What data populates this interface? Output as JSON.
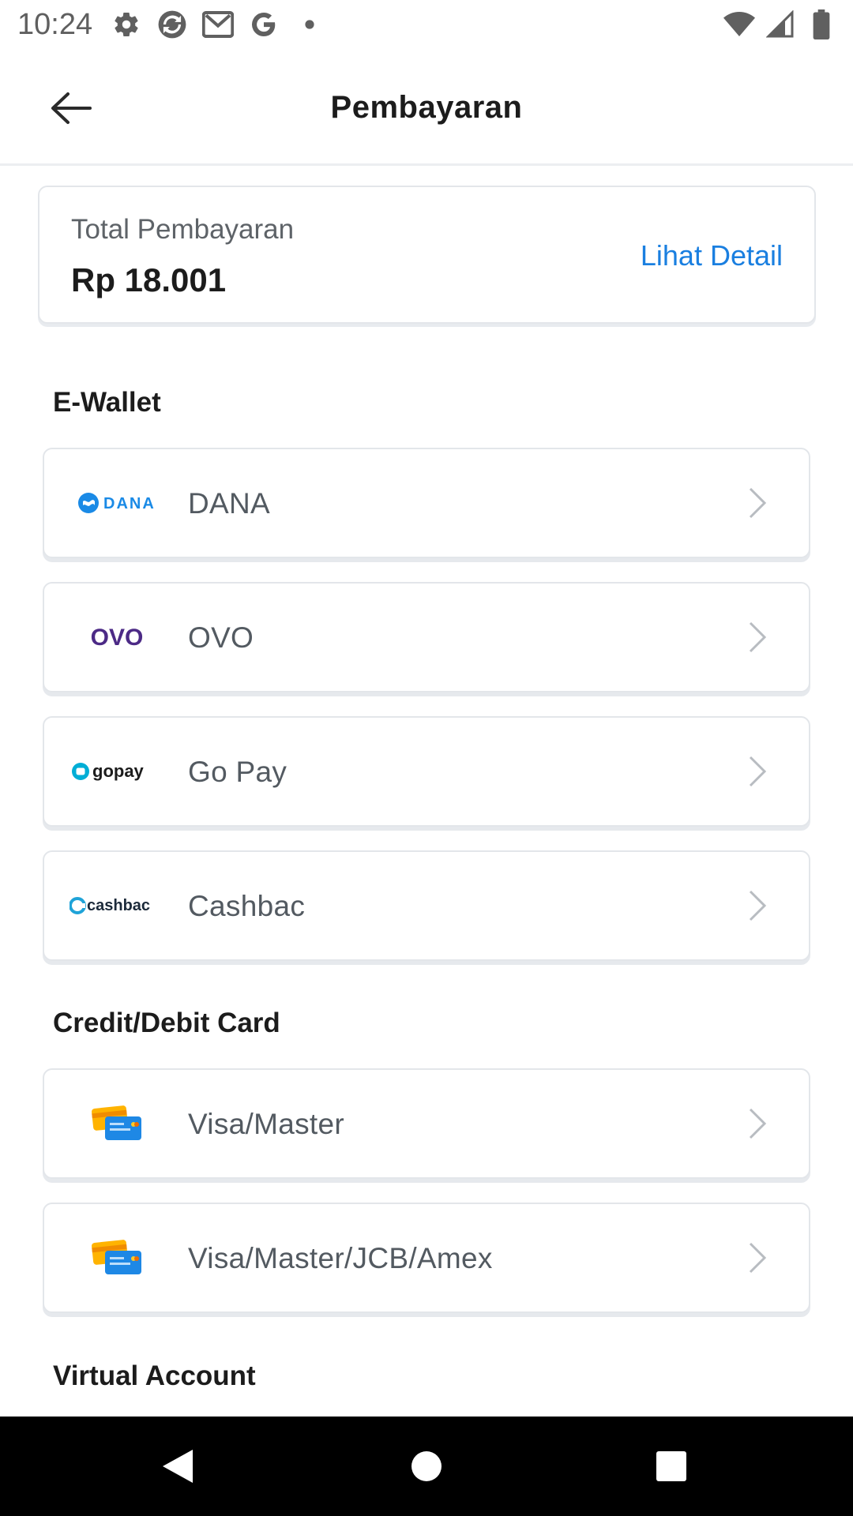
{
  "status_bar": {
    "time": "10:24",
    "left_icons": [
      "settings-icon",
      "sync-icon",
      "gmail-icon",
      "google-icon",
      "dot-icon"
    ],
    "right_icons": [
      "wifi-icon",
      "signal-icon",
      "battery-icon"
    ]
  },
  "app_bar": {
    "title": "Pembayaran",
    "back_icon": "arrow-left-icon"
  },
  "total": {
    "label": "Total Pembayaran",
    "amount": "Rp 18.001",
    "detail_link": "Lihat Detail",
    "link_color": "#1a7fe0"
  },
  "sections": {
    "ewallet": {
      "title": "E-Wallet",
      "items": [
        {
          "label": "DANA",
          "logo_text": "DANA",
          "logo_color": "#1a8ae6"
        },
        {
          "label": "OVO",
          "logo_text": "OVO",
          "logo_color": "#4c2a86"
        },
        {
          "label": "Go Pay",
          "logo_text": "gopay",
          "logo_color": "#00aed6"
        },
        {
          "label": "Cashbac",
          "logo_text": "cashbac",
          "logo_color": "#1fa3d8"
        }
      ]
    },
    "card": {
      "title": "Credit/Debit Card",
      "items": [
        {
          "label": "Visa/Master",
          "icon": "credit-card-icon"
        },
        {
          "label": "Visa/Master/JCB/Amex",
          "icon": "credit-card-icon"
        }
      ]
    },
    "virtual_account": {
      "title": "Virtual Account"
    }
  },
  "nav_bar": {
    "buttons": [
      "back-triangle-icon",
      "home-circle-icon",
      "recents-square-icon"
    ]
  }
}
